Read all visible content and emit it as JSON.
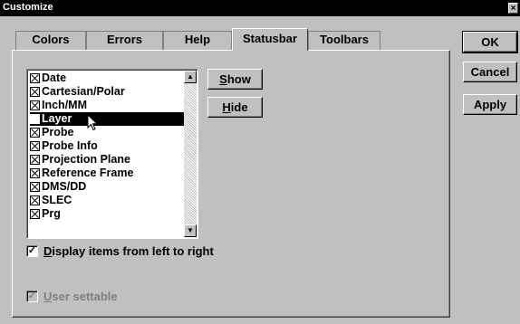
{
  "window": {
    "title": "Customize",
    "close_glyph": "×"
  },
  "tabs": [
    {
      "label": "Colors"
    },
    {
      "label": "Errors"
    },
    {
      "label": "Help"
    },
    {
      "label": "Statusbar",
      "active": true
    },
    {
      "label": "Toolbars"
    }
  ],
  "items": [
    {
      "label": "Date",
      "checked": true
    },
    {
      "label": "Cartesian/Polar",
      "checked": true
    },
    {
      "label": "Inch/MM",
      "checked": true
    },
    {
      "label": "Layer",
      "checked": false,
      "selected": true
    },
    {
      "label": "Probe",
      "checked": true
    },
    {
      "label": "Probe Info",
      "checked": true
    },
    {
      "label": "Projection Plane",
      "checked": true
    },
    {
      "label": "Reference Frame",
      "checked": true
    },
    {
      "label": "DMS/DD",
      "checked": true
    },
    {
      "label": "SLEC",
      "checked": true
    },
    {
      "label": "Prg",
      "checked": true
    }
  ],
  "buttons": {
    "show": {
      "mnemonic": "S",
      "rest": "how"
    },
    "hide": {
      "mnemonic": "H",
      "rest": "ide"
    },
    "ok": "OK",
    "cancel": "Cancel",
    "apply": "Apply"
  },
  "options": {
    "display_ltr": {
      "mnemonic": "D",
      "rest": "isplay items from left to right",
      "checked": true,
      "mark": "✓"
    },
    "user_settable": {
      "mnemonic": "U",
      "rest": "ser settable",
      "checked": true,
      "disabled": true,
      "mark": "✓"
    }
  },
  "scroll": {
    "up_glyph": "▲",
    "down_glyph": "▼"
  }
}
